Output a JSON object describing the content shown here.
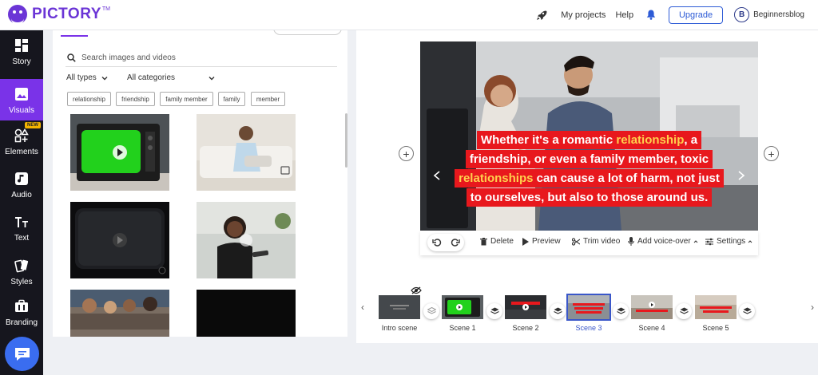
{
  "app": {
    "brand": "PICTORY",
    "trademark": "TM",
    "nav": {
      "projects": "My projects",
      "help": "Help",
      "upgrade": "Upgrade"
    },
    "user": {
      "initial": "B",
      "name": "Beginnersblog"
    },
    "brand_color": "#6b35d6"
  },
  "sidebar": {
    "active_color": "#7a33e8",
    "items": [
      {
        "label": "Story",
        "icon": "story-icon"
      },
      {
        "label": "Visuals",
        "icon": "image-icon",
        "active": true
      },
      {
        "label": "Elements",
        "icon": "shapes-icon",
        "badge": "NEW"
      },
      {
        "label": "Audio",
        "icon": "music-icon"
      },
      {
        "label": "Text",
        "icon": "text-icon"
      },
      {
        "label": "Styles",
        "icon": "styles-icon"
      },
      {
        "label": "Branding",
        "icon": "briefcase-icon"
      }
    ]
  },
  "media": {
    "search_placeholder": "Search images and videos",
    "filters": {
      "type": "All types",
      "category": "All categories"
    },
    "tags": [
      "relationship",
      "friendship",
      "family member",
      "family",
      "member"
    ]
  },
  "preview": {
    "caption_lines": [
      {
        "before": "Whether it's a romantic ",
        "highlight": "relationship",
        "after": ", a"
      },
      {
        "before": "friendship, or even a family member, toxic",
        "highlight": "",
        "after": ""
      },
      {
        "before": "",
        "highlight": "relationships",
        "after": " can cause a lot of harm, not just"
      },
      {
        "before": "to ourselves, but also to those around us.",
        "highlight": "",
        "after": ""
      }
    ],
    "caption_bg": "#e8181d",
    "highlight_color": "#ffd04d"
  },
  "toolbar": {
    "delete": "Delete",
    "preview": "Preview",
    "trim": "Trim video",
    "voice": "Add voice-over",
    "settings": "Settings"
  },
  "timeline": {
    "scenes": [
      "Intro scene",
      "Scene 1",
      "Scene 2",
      "Scene 3",
      "Scene 4",
      "Scene 5"
    ],
    "active_scene": "Scene 3",
    "active_color": "#3a57c9"
  }
}
